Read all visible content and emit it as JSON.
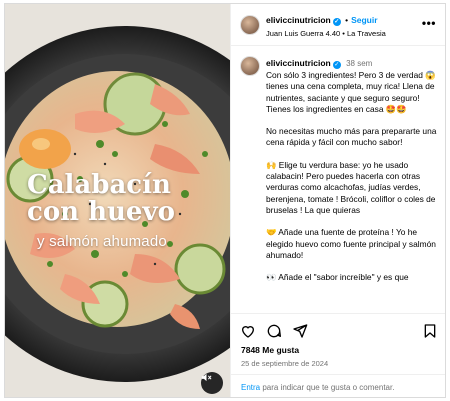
{
  "media": {
    "overlay_title": "Calabacín con huevo",
    "overlay_subtitle": "y salmón ahumado",
    "mute_icon": "speaker-muted-icon"
  },
  "header": {
    "username": "eliviccinutricion",
    "follow_label": "Seguir",
    "separator": "•",
    "audio": "Juan Luis Guerra 4.40 • La Travesia",
    "more_icon": "•••"
  },
  "caption": {
    "username": "eliviccinutricion",
    "time": "38 sem",
    "paragraphs": [
      "Con sólo 3 ingredientes! Pero 3 de verdad 😱 tienes una cena completa, muy rica! Llena de nutrientes, saciante y que seguro seguro! Tienes los ingredientes en casa 🤩🤩",
      "No necesitas mucho más para prepararte una cena rápida y fácil con mucho sabor!",
      "🙌 Elige tu verdura base: yo he usado calabacin! Pero puedes hacerla con otras verduras como alcachofas, judías verdes, berenjena, tomate ! Brócoli, coliflor o coles de bruselas ! La que quieras",
      "🤝 Añade una fuente de proteína ! Yo he elegido huevo como fuente principal y salmón ahumado!",
      "👀 Añade el \"sabor increíble\" y es que"
    ]
  },
  "actions": {
    "likes": "7848 Me gusta",
    "date": "25 de septiembre de 2024",
    "login_link": "Entra",
    "login_text": " para indicar que te gusta o comentar."
  },
  "colors": {
    "accent": "#0095f6",
    "muted_text": "#737373",
    "border": "#dbdbdb"
  }
}
